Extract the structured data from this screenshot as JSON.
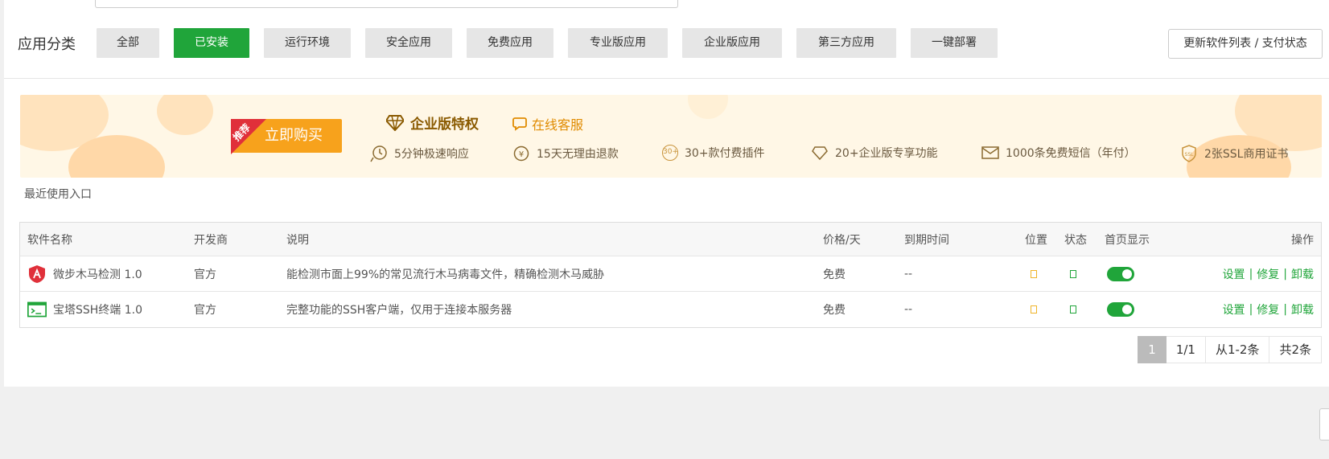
{
  "category": {
    "label": "应用分类",
    "buttons": [
      {
        "label": "全部"
      },
      {
        "label": "已安装",
        "active": true
      },
      {
        "label": "运行环境"
      },
      {
        "label": "安全应用"
      },
      {
        "label": "免费应用"
      },
      {
        "label": "专业版应用"
      },
      {
        "label": "企业版应用"
      },
      {
        "label": "第三方应用"
      },
      {
        "label": "一键部署"
      }
    ],
    "update_label": "更新软件列表 / 支付状态"
  },
  "banner": {
    "ribbon": "推荐",
    "buy_label": "立即购买",
    "ent_title": "企业版特权",
    "cs_label": "在线客服",
    "features": [
      {
        "icon": "clock-icon",
        "label": "5分钟极速响应"
      },
      {
        "icon": "refund-icon",
        "label": "15天无理由退款"
      },
      {
        "icon": "plugin-icon",
        "label": "30+款付费插件",
        "badge": "30+"
      },
      {
        "icon": "diamond-icon",
        "label": "20+企业版专享功能"
      },
      {
        "icon": "mail-icon",
        "label": "1000条免费短信（年付）"
      },
      {
        "icon": "ssl-icon",
        "label": "2张SSL商用证书"
      }
    ]
  },
  "recent_label": "最近使用入口",
  "table": {
    "headers": {
      "name": "软件名称",
      "developer": "开发商",
      "desc": "说明",
      "price": "价格/天",
      "expire": "到期时间",
      "position": "位置",
      "status": "状态",
      "home": "首页显示",
      "ops": "操作"
    },
    "rows": [
      {
        "icon": "shield-icon",
        "name": "微步木马检测 1.0",
        "developer": "官方",
        "desc": "能检测市面上99%的常见流行木马病毒文件，精确检测木马威胁",
        "price": "免费",
        "expire": "--",
        "ops": [
          "设置",
          "修复",
          "卸载"
        ]
      },
      {
        "icon": "terminal-icon",
        "name": "宝塔SSH终端 1.0",
        "developer": "官方",
        "desc": "完整功能的SSH客户端，仅用于连接本服务器",
        "price": "免费",
        "expire": "--",
        "ops": [
          "设置",
          "修复",
          "卸载"
        ]
      }
    ],
    "separator": "|"
  },
  "pager": {
    "current": "1",
    "pages": "1/1",
    "range": "从1-2条",
    "total": "共2条"
  },
  "colors": {
    "accent": "#20a53a",
    "banner_bg": "#fff7e6",
    "buy": "#f7a21c",
    "ribbon": "#e0303a"
  }
}
